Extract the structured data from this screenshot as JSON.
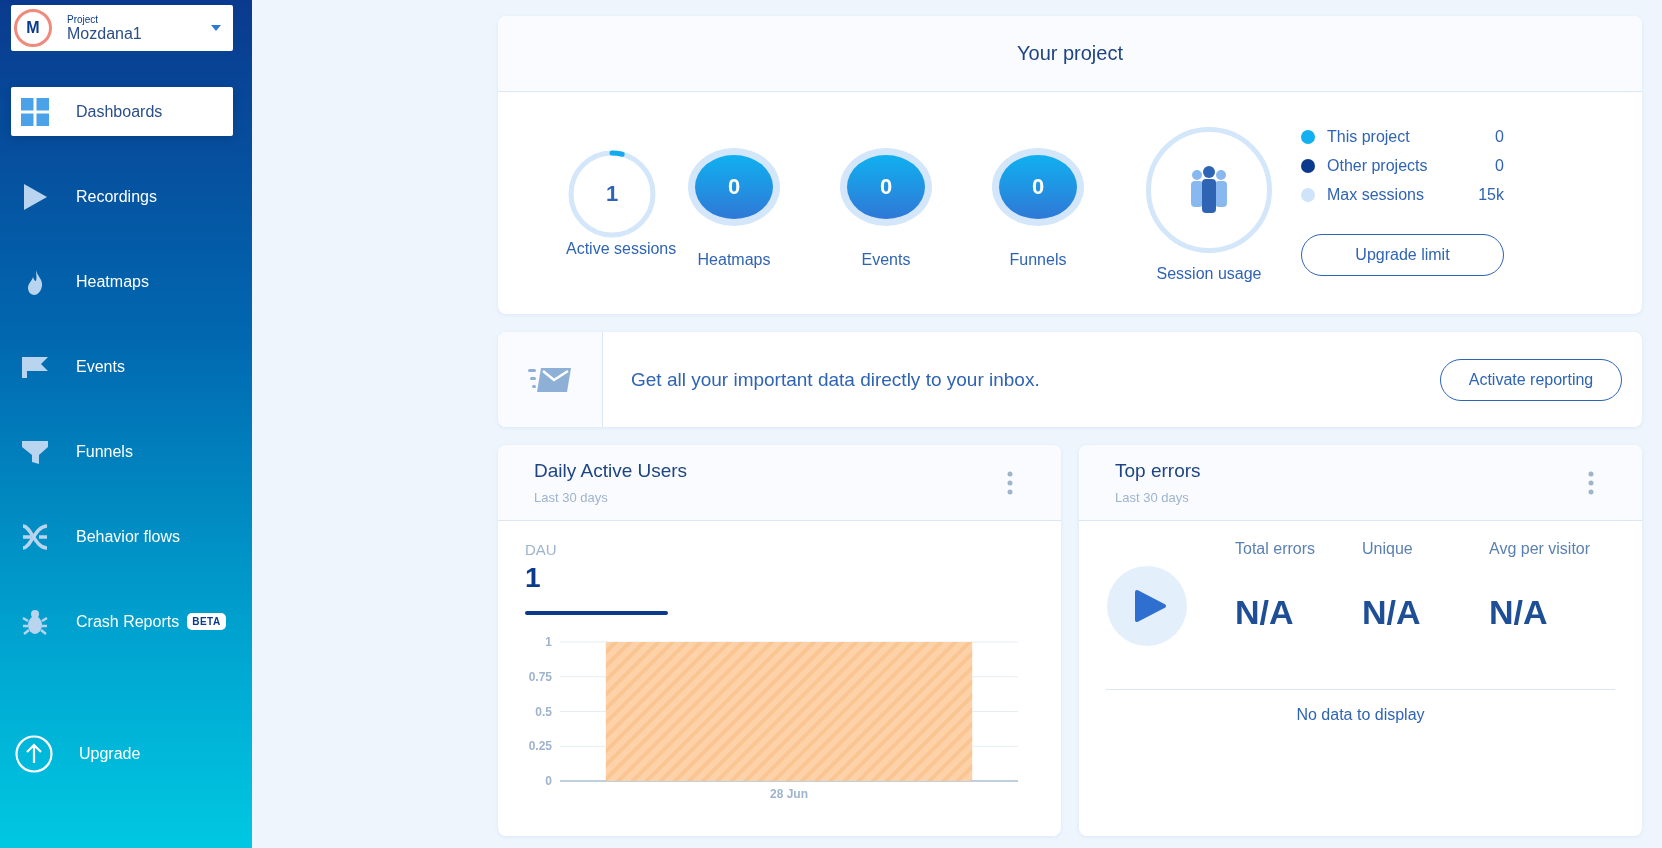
{
  "project_switcher": {
    "avatar": "M",
    "label": "Project",
    "name": "Mozdana1"
  },
  "sidebar": {
    "items": [
      {
        "label": "Dashboards",
        "selected": true
      },
      {
        "label": "Recordings",
        "selected": false
      },
      {
        "label": "Heatmaps",
        "selected": false
      },
      {
        "label": "Events",
        "selected": false
      },
      {
        "label": "Funnels",
        "selected": false
      },
      {
        "label": "Behavior flows",
        "selected": false
      },
      {
        "label": "Crash Reports",
        "selected": false,
        "badge": "BETA"
      }
    ],
    "upgrade": "Upgrade"
  },
  "project_card": {
    "title": "Your project",
    "stats": [
      {
        "kind": "ring",
        "value": "1",
        "label": "Active sessions",
        "level": 0.04
      },
      {
        "kind": "filled",
        "value": "0",
        "label": "Heatmaps"
      },
      {
        "kind": "filled",
        "value": "0",
        "label": "Events"
      },
      {
        "kind": "filled",
        "value": "0",
        "label": "Funnels"
      },
      {
        "kind": "icon",
        "label": "Session usage"
      }
    ],
    "legend": [
      {
        "label": "This project",
        "value": "0",
        "color": "#12b0f0"
      },
      {
        "label": "Other projects",
        "value": "0",
        "color": "#0b3a8c"
      },
      {
        "label": "Max sessions",
        "value": "15k",
        "color": "#cfe4fa"
      }
    ],
    "button": "Upgrade limit"
  },
  "reporting_banner": {
    "text": "Get all your important data directly to your inbox.",
    "button": "Activate reporting"
  },
  "daily_active_users": {
    "title": "Daily Active Users",
    "subtitle": "Last 30 days",
    "metric_label": "DAU",
    "metric_value": "1",
    "chart_data": {
      "type": "bar",
      "categories": [
        "28 Jun"
      ],
      "values": [
        1
      ],
      "ylim": [
        0,
        1
      ],
      "yticks": [
        0,
        0.25,
        0.5,
        0.75,
        1
      ],
      "grid": true
    }
  },
  "top_errors": {
    "title": "Top errors",
    "subtitle": "Last 30 days",
    "metrics": [
      {
        "label": "Total errors",
        "value": "N/A"
      },
      {
        "label": "Unique",
        "value": "N/A"
      },
      {
        "label": "Avg per visitor",
        "value": "N/A"
      }
    ],
    "empty_message": "No data to display"
  }
}
